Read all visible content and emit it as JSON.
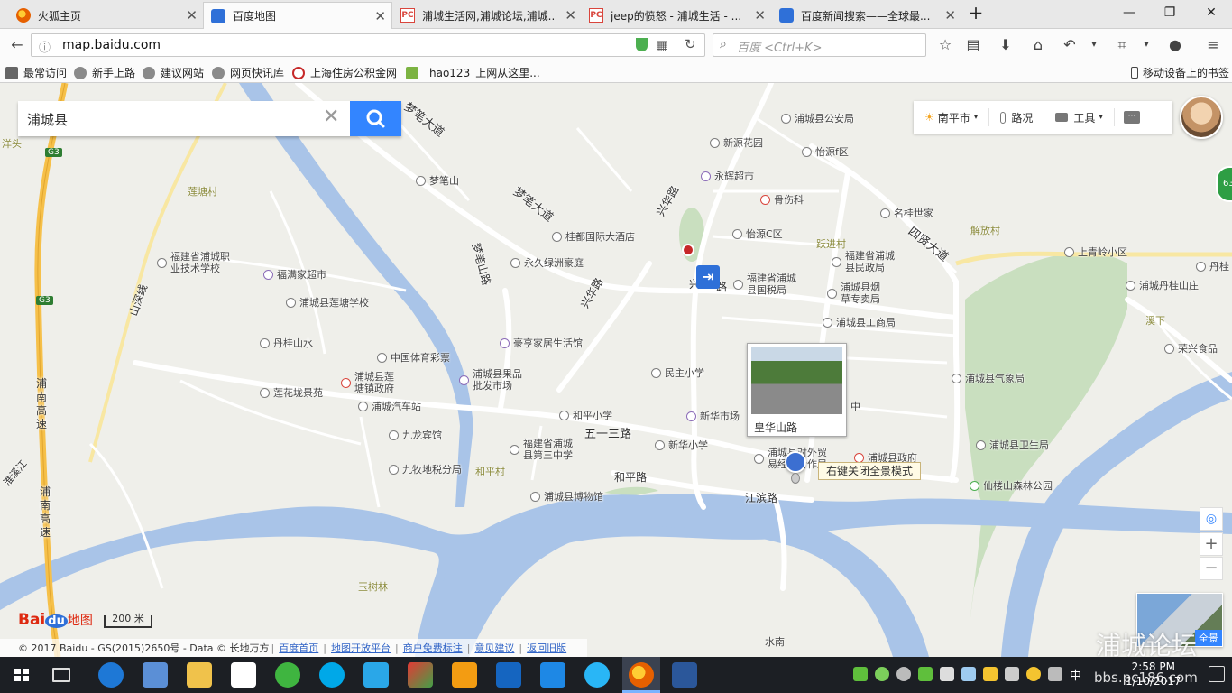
{
  "browser": {
    "tabs": [
      {
        "title": "火狐主页",
        "icon": "firefox-icon",
        "color": "#e66000"
      },
      {
        "title": "百度地图",
        "icon": "baidu-paw-icon",
        "color": "#2f70d8"
      },
      {
        "title": "浦城生活网,浦城论坛,浦城...",
        "icon": "pc-site-icon",
        "color": "#d9453c"
      },
      {
        "title": "jeep的愤怒 - 浦城生活 - ...",
        "icon": "pc-site-icon",
        "color": "#d9453c"
      },
      {
        "title": "百度新闻搜索——全球最...",
        "icon": "baidu-paw-icon",
        "color": "#2f70d8"
      }
    ],
    "new_tab": "+",
    "window_controls": {
      "minimize": "—",
      "restore": "❐",
      "close": "✕"
    },
    "url_host": "map.baidu.com",
    "search_placeholder": "百度 <Ctrl+K>",
    "bookmarks": [
      "最常访问",
      "新手上路",
      "建议网站",
      "网页快讯库",
      "上海住房公积金网",
      "hao123_上网从这里..."
    ],
    "mobile_bookmarks": "移动设备上的书签"
  },
  "map": {
    "search_query": "浦城县",
    "tools": {
      "city": "南平市",
      "traffic": "路况",
      "tools": "工具"
    },
    "route_badge": "63",
    "scale": "200 米",
    "logo": {
      "bai": "Bai",
      "du": "du",
      "ditu": "地图"
    },
    "copyright": "© 2017 Baidu - GS(2015)2650号 - Data © 长地万方",
    "footer_links": [
      "百度首页",
      "地图开放平台",
      "商户免费标注",
      "意见建议",
      "返回旧版"
    ],
    "pano_card": {
      "name": "皇华山路"
    },
    "pano_tip": "右键关闭全景模式",
    "pano_thumb_label": "全景",
    "watermark": "浦城论坛",
    "highway_labels": [
      "G3",
      "G3"
    ],
    "road_labels": [
      {
        "text": "梦笔大道",
        "rot": 38
      },
      {
        "text": "梦笔大道",
        "rot": 38
      },
      {
        "text": "兴华路",
        "rot": -60
      },
      {
        "text": "兴华路",
        "rot": -60
      },
      {
        "text": "兴",
        "rot": 0
      },
      {
        "text": "路",
        "rot": 0
      },
      {
        "text": "四贤大道",
        "rot": 38
      },
      {
        "text": "五一三路",
        "rot": 0
      },
      {
        "text": "和平路",
        "rot": 0
      },
      {
        "text": "江滨路",
        "rot": 0
      },
      {
        "text": "梦笔山路",
        "rot": 75
      },
      {
        "text": "山深线",
        "rot": -70
      },
      {
        "text": "浦南高速",
        "rot": 0
      },
      {
        "text": "浦南高速",
        "rot": 0
      },
      {
        "text": "淮溪江",
        "rot": -50
      }
    ],
    "area_labels": [
      "莲塘村",
      "跃进村",
      "解放村",
      "和平村",
      "玉树林",
      "溪下",
      "水南",
      "洋头"
    ],
    "pois": [
      {
        "name": "浦城县公安局",
        "color": "grey"
      },
      {
        "name": "新源花园",
        "color": "grey"
      },
      {
        "name": "怡源f区",
        "color": "grey"
      },
      {
        "name": "永辉超市",
        "color": "purple"
      },
      {
        "name": "骨伤科",
        "color": "red"
      },
      {
        "name": "名桂世家",
        "color": "grey"
      },
      {
        "name": "梦笔山",
        "color": "grey"
      },
      {
        "name": "桂都国际大酒店",
        "color": "grey"
      },
      {
        "name": "怡源C区",
        "color": "grey"
      },
      {
        "name": "永久绿洲豪庭",
        "color": "grey"
      },
      {
        "name": "福建省浦城职\n业技术学校",
        "color": "grey"
      },
      {
        "name": "福满家超市",
        "color": "purple"
      },
      {
        "name": "浦城县莲塘学校",
        "color": "grey"
      },
      {
        "name": "福建省浦城\n县国税局",
        "color": "grey"
      },
      {
        "name": "福建省浦城\n县民政局",
        "color": "grey"
      },
      {
        "name": "浦城县烟\n草专卖局",
        "color": "grey"
      },
      {
        "name": "浦城县工商局",
        "color": "grey"
      },
      {
        "name": "上青岭小区",
        "color": "grey"
      },
      {
        "name": "浦城丹桂山庄",
        "color": "grey"
      },
      {
        "name": "丹桂",
        "color": "grey"
      },
      {
        "name": "荣兴食品",
        "color": "grey"
      },
      {
        "name": "丹桂山水",
        "color": "grey"
      },
      {
        "name": "豪亨家居生活馆",
        "color": "purple"
      },
      {
        "name": "中国体育彩票",
        "color": "grey"
      },
      {
        "name": "浦城县莲\n塘镇政府",
        "color": "red"
      },
      {
        "name": "浦城县果品\n批发市场",
        "color": "purple"
      },
      {
        "name": "莲花垅景苑",
        "color": "grey"
      },
      {
        "name": "民主小学",
        "color": "grey"
      },
      {
        "name": "浦城县气象局",
        "color": "grey"
      },
      {
        "name": "浦城汽车站",
        "color": "grey"
      },
      {
        "name": "新华市场",
        "color": "purple"
      },
      {
        "name": "和平小学",
        "color": "grey"
      },
      {
        "name": "中",
        "color": "grey"
      },
      {
        "name": "九龙宾馆",
        "color": "grey"
      },
      {
        "name": "新华小学",
        "color": "grey"
      },
      {
        "name": "福建省浦城\n县第三中学",
        "color": "grey"
      },
      {
        "name": "浦城县对外贸\n易经济合作局",
        "color": "grey"
      },
      {
        "name": "浦城县政府",
        "color": "red"
      },
      {
        "name": "浦城县卫生局",
        "color": "grey"
      },
      {
        "name": "九牧地税分局",
        "color": "grey"
      },
      {
        "name": "浦城县博物馆",
        "color": "grey"
      },
      {
        "name": "仙楼山森林公园",
        "color": "grey"
      }
    ]
  },
  "taskbar": {
    "apps": [
      "start",
      "task-view",
      "edge",
      "explorer-alt",
      "folder",
      "store",
      "wechat",
      "skype",
      "qq-browser",
      "360",
      "outlook",
      "kd",
      "baidu-cloud",
      "qq",
      "firefox",
      "word"
    ],
    "ime": "中",
    "clock_time": "2:58 PM",
    "clock_date": "1/10/2017",
    "tb_watermark": "bbs.pc186.com"
  }
}
